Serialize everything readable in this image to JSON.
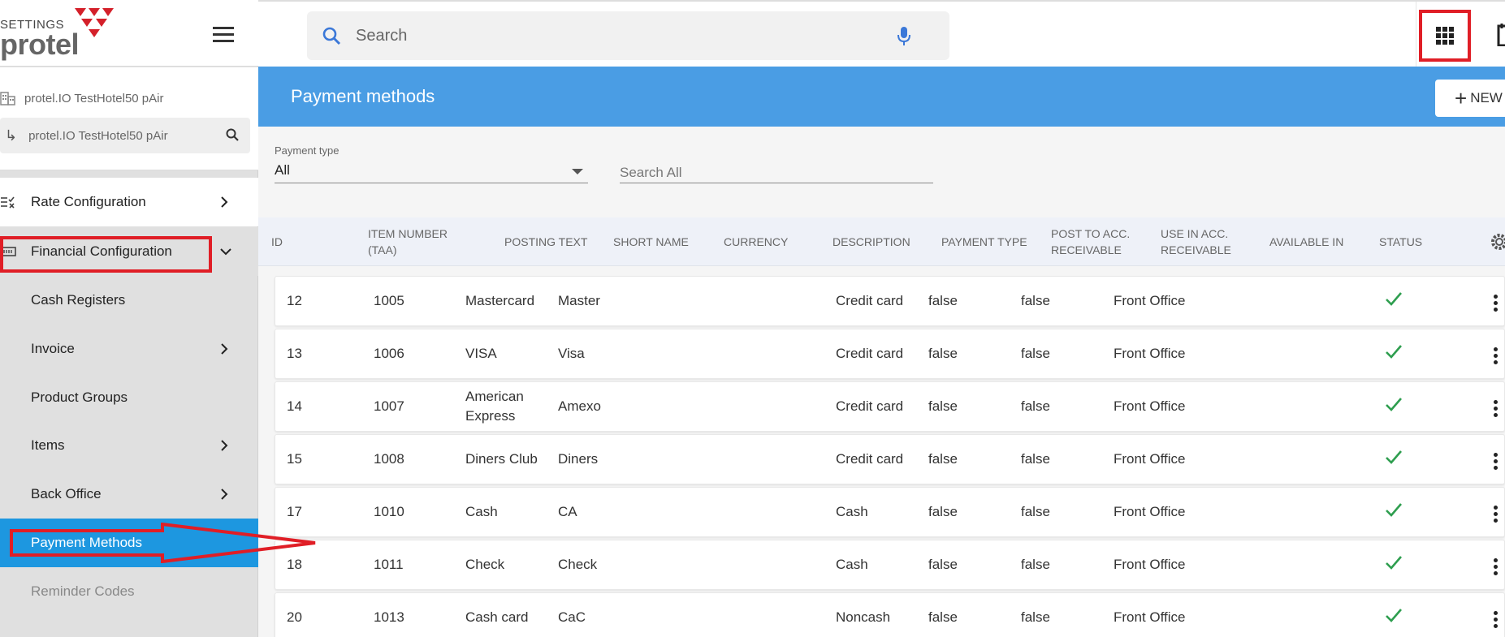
{
  "logo": {
    "settings_text": "SETTINGS",
    "brand_text": "protel"
  },
  "hotel": {
    "name": "protel.IO TestHotel50 pAir",
    "selected": "protel.IO TestHotel50 pAir"
  },
  "nav": {
    "rate_configuration": "Rate Configuration",
    "financial_configuration": "Financial Configuration",
    "children": [
      {
        "label": "Cash Registers",
        "has_chevron": false
      },
      {
        "label": "Invoice",
        "has_chevron": true
      },
      {
        "label": "Product Groups",
        "has_chevron": false
      },
      {
        "label": "Items",
        "has_chevron": true
      },
      {
        "label": "Back Office",
        "has_chevron": true
      },
      {
        "label": "Payment Methods",
        "has_chevron": false,
        "active": true
      },
      {
        "label": "Reminder Codes",
        "has_chevron": false,
        "muted": true
      }
    ]
  },
  "topbar": {
    "search_placeholder": "Search"
  },
  "page": {
    "title": "Payment methods",
    "new_button": "NEW"
  },
  "filters": {
    "payment_type_label": "Payment type",
    "payment_type_value": "All",
    "search_all_placeholder": "Search All"
  },
  "table": {
    "columns": [
      "ID",
      "ITEM NUMBER (TAA)",
      "POSTING TEXT",
      "SHORT NAME",
      "CURRENCY",
      "DESCRIPTION",
      "PAYMENT TYPE",
      "POST TO ACC. RECEIVABLE",
      "USE IN ACC. RECEIVABLE",
      "AVAILABLE IN",
      "STATUS"
    ],
    "rows": [
      {
        "id": "12",
        "item_number": "1005",
        "posting_text": "Mastercard",
        "short_name": "Master",
        "currency": "",
        "description": "",
        "payment_type": "Credit card",
        "post_to_acc": "false",
        "use_in_acc": "false",
        "available_in": "Front Office",
        "status": "active"
      },
      {
        "id": "13",
        "item_number": "1006",
        "posting_text": "VISA",
        "short_name": "Visa",
        "currency": "",
        "description": "",
        "payment_type": "Credit card",
        "post_to_acc": "false",
        "use_in_acc": "false",
        "available_in": "Front Office",
        "status": "active"
      },
      {
        "id": "14",
        "item_number": "1007",
        "posting_text": "American Express",
        "short_name": "Amexo",
        "currency": "",
        "description": "",
        "payment_type": "Credit card",
        "post_to_acc": "false",
        "use_in_acc": "false",
        "available_in": "Front Office",
        "status": "active"
      },
      {
        "id": "15",
        "item_number": "1008",
        "posting_text": "Diners Club",
        "short_name": "Diners",
        "currency": "",
        "description": "",
        "payment_type": "Credit card",
        "post_to_acc": "false",
        "use_in_acc": "false",
        "available_in": "Front Office",
        "status": "active"
      },
      {
        "id": "17",
        "item_number": "1010",
        "posting_text": "Cash",
        "short_name": "CA",
        "currency": "",
        "description": "",
        "payment_type": "Cash",
        "post_to_acc": "false",
        "use_in_acc": "false",
        "available_in": "Front Office",
        "status": "active"
      },
      {
        "id": "18",
        "item_number": "1011",
        "posting_text": "Check",
        "short_name": "Check",
        "currency": "",
        "description": "",
        "payment_type": "Cash",
        "post_to_acc": "false",
        "use_in_acc": "false",
        "available_in": "Front Office",
        "status": "active"
      },
      {
        "id": "20",
        "item_number": "1013",
        "posting_text": "Cash card",
        "short_name": "CaC",
        "currency": "",
        "description": "",
        "payment_type": "Noncash",
        "post_to_acc": "false",
        "use_in_acc": "false",
        "available_in": "Front Office",
        "status": "active"
      }
    ]
  },
  "colors": {
    "accent": "#1d97e0",
    "header_band": "#4a9de4",
    "annotation_red": "#e01e26",
    "status_green": "#2e9e4f",
    "brand_red": "#d4202a"
  },
  "icons": {
    "search": "search-icon",
    "mic": "mic-icon",
    "apps": "apps-grid-icon",
    "calendar": "calendar-icon",
    "settings": "gear-icon",
    "more": "more-vert-icon",
    "status": "check-icon"
  }
}
